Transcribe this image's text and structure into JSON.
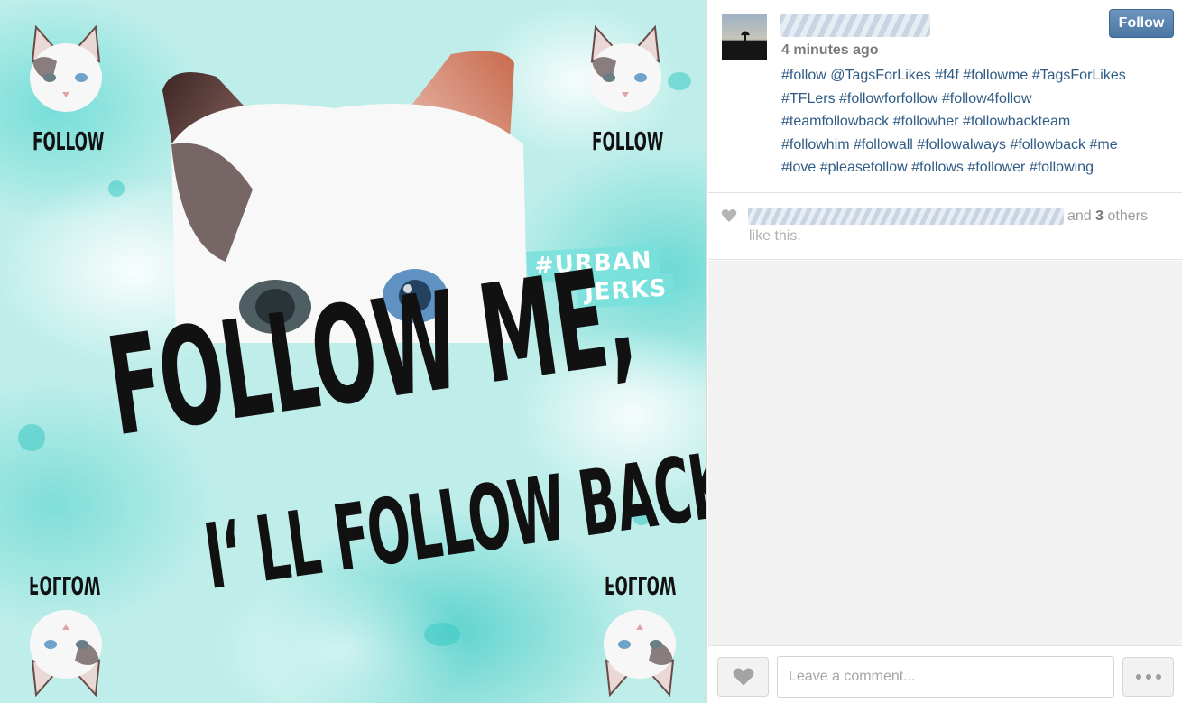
{
  "photo": {
    "headline_line1": "FOLLOW ME,",
    "headline_line2": "I‘ LL FOLLOW BACK",
    "tag_line1": "#URBAN",
    "tag_line2": "JERKS",
    "corner_label": "FOLLOW",
    "accent_color": "#bfeeea"
  },
  "post": {
    "timestamp": "4 minutes ago",
    "follow_label": "Follow",
    "caption_lines": [
      "#follow @TagsForLikes #f4f #followme #TagsForLikes",
      "#TFLers #followforfollow #follow4follow",
      "#teamfollowback #followher #followbackteam",
      "#followhim #followall #followalways #followback #me",
      "#love #pleasefollow #follows #follower #following"
    ],
    "link_color": "#2f5b85"
  },
  "likes": {
    "prefix": "and ",
    "count": "3",
    "suffix": " others",
    "line2": "like this."
  },
  "comment": {
    "placeholder": "Leave a comment..."
  },
  "icons": {
    "like": "heart-icon",
    "more": "ellipsis-icon"
  }
}
